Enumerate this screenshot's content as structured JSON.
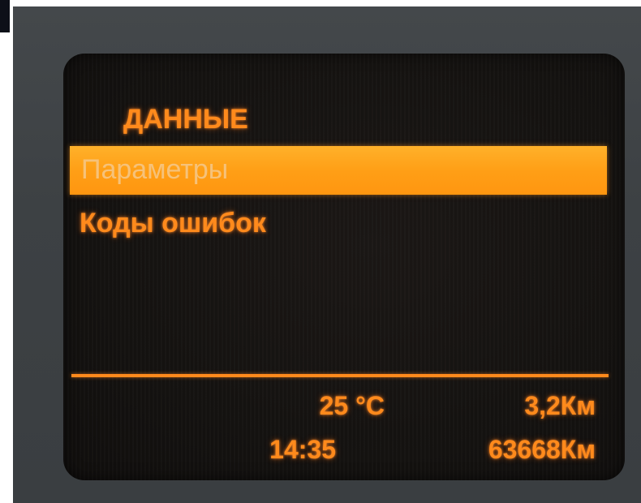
{
  "display": {
    "menu_title": "ДАННЫЕ",
    "menu_items": [
      {
        "label": "Параметры",
        "selected": true
      },
      {
        "label": "Коды ошибок",
        "selected": false
      }
    ],
    "status": {
      "temperature": "25 °C",
      "trip_distance": "3,2Км",
      "time": "14:35",
      "odometer": "63668Км"
    }
  },
  "colors": {
    "text": "#ff8a1c",
    "highlight": "#ffa41c",
    "screen_background": "#141210",
    "bezel": "#3d4144"
  }
}
